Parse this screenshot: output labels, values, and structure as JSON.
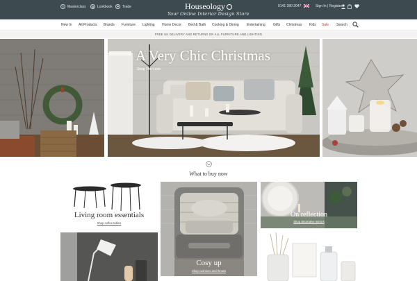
{
  "topbar": {
    "links": [
      {
        "label": "Masterclass",
        "icon": "graduation-cap-icon"
      },
      {
        "label": "Lookbook",
        "icon": "book-icon"
      },
      {
        "label": "Trade",
        "icon": "trade-icon"
      }
    ],
    "logo": "Houseology",
    "tagline": "Your Online Interior Design Store",
    "phone": "0141 280 2047",
    "account": "Sign In | Register",
    "basket_count": "0"
  },
  "nav": {
    "items": [
      "New In",
      "All Products",
      "Brands",
      "Furniture",
      "Lighting",
      "Home Decor",
      "Bed & Bath",
      "Cooking & Dining",
      "Entertaining",
      "Gifts",
      "Christmas",
      "Kids",
      "Sale",
      "Search"
    ]
  },
  "delivery_banner": "FREE UK DELIVERY AND RETURNS ON ALL FURNITURE AND LIGHTING",
  "hero": {
    "title": "A Very Chic Christmas",
    "cta": "Shop The Look"
  },
  "what_to_buy": {
    "title": "What to buy now",
    "tiles": [
      {
        "title": "Living room essentials",
        "link": "Shop coffee tables"
      },
      {
        "title": "Cosy up",
        "link": "Shop cushions and throws"
      },
      {
        "title": "On reflection",
        "link": "Shop decorative mirrors"
      }
    ]
  },
  "colors": {
    "topbar": "#3d4a4f",
    "sale": "#d43a2f"
  }
}
